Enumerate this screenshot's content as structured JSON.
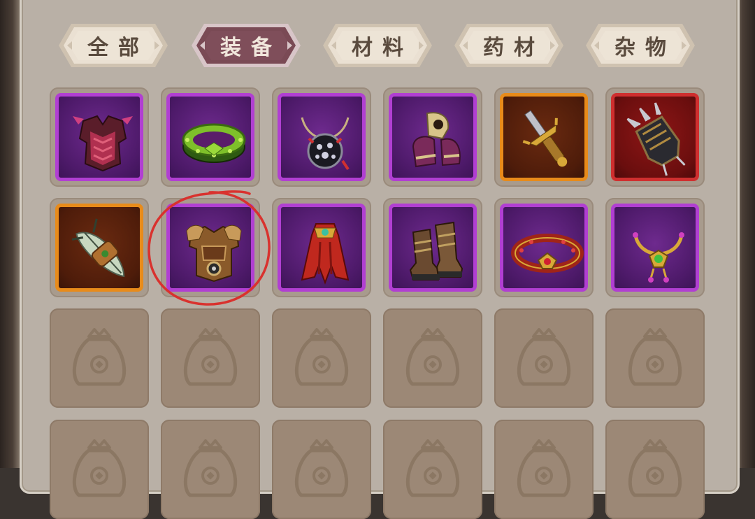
{
  "tabs": [
    {
      "label": "全部",
      "active": false
    },
    {
      "label": "装备",
      "active": true
    },
    {
      "label": "材料",
      "active": false
    },
    {
      "label": "药材",
      "active": false
    },
    {
      "label": "杂物",
      "active": false
    }
  ],
  "colors": {
    "rarity_purple": "#b13fd2",
    "rarity_orange": "#e88b1a",
    "rarity_red": "#cf2f2f",
    "tab_active": "#7a4a55",
    "tab_inactive": "#eae0d2",
    "annotation": "#d9322e"
  },
  "inventory": {
    "row1": [
      {
        "item": "chest-armor",
        "rarity": "purple"
      },
      {
        "item": "jade-ring",
        "rarity": "purple"
      },
      {
        "item": "dark-necklace",
        "rarity": "purple"
      },
      {
        "item": "shoulder-guard",
        "rarity": "purple"
      },
      {
        "item": "golden-dagger",
        "rarity": "orange"
      },
      {
        "item": "spiked-gauntlet",
        "rarity": "red"
      }
    ],
    "row2": [
      {
        "item": "feather-bracer",
        "rarity": "orange"
      },
      {
        "item": "bronze-armor",
        "rarity": "purple",
        "circled": true
      },
      {
        "item": "red-cloak",
        "rarity": "purple"
      },
      {
        "item": "leather-boots",
        "rarity": "purple"
      },
      {
        "item": "ruby-belt",
        "rarity": "purple"
      },
      {
        "item": "gem-necklace",
        "rarity": "purple"
      }
    ],
    "empty_slot_icon": "money-bag-icon"
  }
}
